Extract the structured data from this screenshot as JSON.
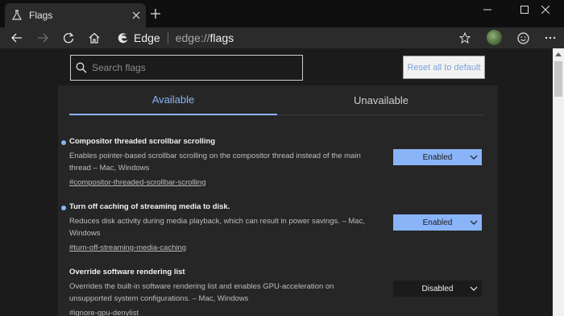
{
  "browser": {
    "tab_title": "Flags",
    "site_name": "Edge",
    "url_scheme": "edge://",
    "url_host": "flags"
  },
  "search": {
    "placeholder": "Search flags"
  },
  "reset_label": "Reset all to default",
  "tabs": [
    {
      "label": "Available"
    },
    {
      "label": "Unavailable"
    }
  ],
  "flags": [
    {
      "title": "Compositor threaded scrollbar scrolling",
      "description": "Enables pointer-based scrollbar scrolling on the compositor thread instead of the main thread – Mac, Windows",
      "link": "#compositor-threaded-scrollbar-scrolling",
      "value": "Enabled"
    },
    {
      "title": "Turn off caching of streaming media to disk.",
      "description": "Reduces disk activity during media playback, which can result in power savings. – Mac, Windows",
      "link": "#turn-off-streaming-media-caching",
      "value": "Enabled"
    },
    {
      "title": "Override software rendering list",
      "description": "Overrides the built-in software rendering list and enables GPU-acceleration on unsupported system configurations. – Mac, Windows",
      "link": "#ignore-gpu-denylist",
      "value": "Disabled"
    }
  ],
  "colors": {
    "accent": "#8ab4f8",
    "background": "#1b1b1b",
    "panel": "#262626"
  }
}
